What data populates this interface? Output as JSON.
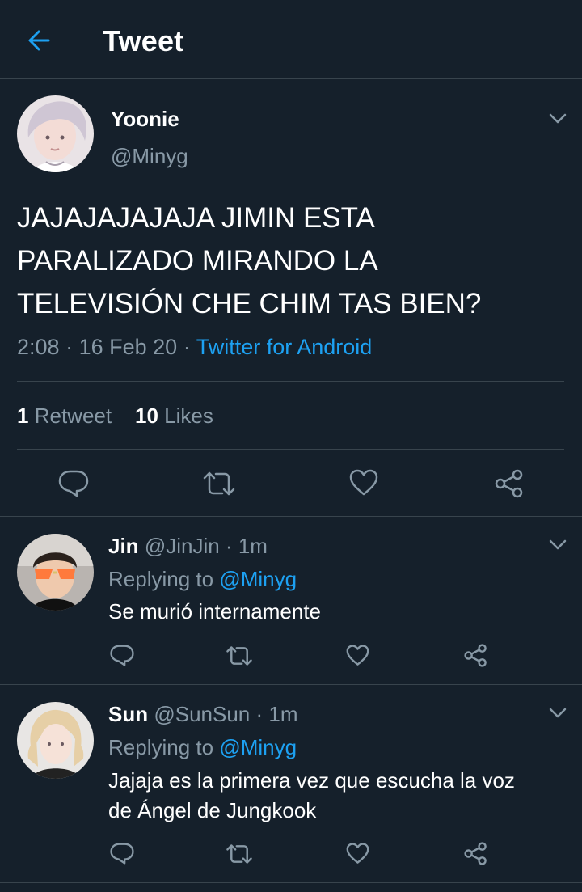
{
  "header": {
    "title": "Tweet",
    "back_icon": "back-arrow-icon"
  },
  "colors": {
    "background": "#15202b",
    "accent": "#1da1f2",
    "muted": "#8899a6",
    "divider": "#38444d"
  },
  "main_tweet": {
    "name": "Yoonie",
    "handle": "@Minyg",
    "text": "JAJAJAJAJAJA JIMIN ESTA\nPARALIZADO MIRANDO LA\nTELEVISIÓN CHE CHIM TAS BIEN?",
    "time": "2:08",
    "date": "16 Feb 20",
    "dot": "·",
    "source": "Twitter for Android",
    "retweet_count": "1",
    "retweet_label": "Retweet",
    "like_count": "10",
    "like_label": "Likes"
  },
  "replies": [
    {
      "name": "Jin",
      "handle": "@JinJin",
      "time": "1m",
      "replying_label": "Replying to",
      "replying_to": "@Minyg",
      "text": "Se murió internamente"
    },
    {
      "name": "Sun",
      "handle": "@SunSun",
      "time": "1m",
      "replying_label": "Replying to",
      "replying_to": "@Minyg",
      "text": "Jajaja es la primera vez que escucha la voz\nde Ángel de Jungkook"
    }
  ]
}
